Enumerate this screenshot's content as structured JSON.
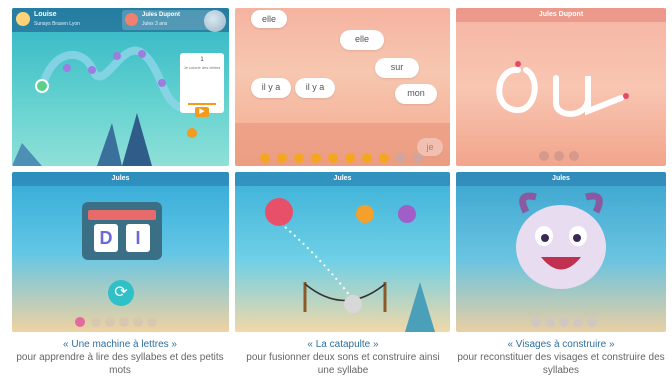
{
  "panel1": {
    "user_name": "Louise",
    "user_sub": "Sunays Brasen Lyon",
    "user2_name": "Jules Dupont",
    "user2_sub": "Jules 3 ans",
    "card_line": "Je colorie des lettres",
    "card_num": "1"
  },
  "panel2": {
    "words": [
      "elle",
      "elle",
      "sur",
      "il y a",
      "il y a",
      "mon",
      "je"
    ]
  },
  "panel3": {
    "title": "Jules Dupont",
    "word": "ou"
  },
  "panel4": {
    "title": "Jules",
    "letters": [
      "D",
      "I"
    ]
  },
  "panel5": {
    "title": "Jules"
  },
  "panel6": {
    "title": "Jules"
  },
  "captions": [
    {
      "title": "« Une machine à lettres »",
      "body": "pour apprendre à lire des syllabes et des petits mots"
    },
    {
      "title": "« La catapulte »",
      "body": "pour fusionner deux sons et construire ainsi une syllabe"
    },
    {
      "title": "« Visages à construire »",
      "body": "pour reconstituer des visages et construire des syllabes"
    }
  ],
  "colors": {
    "accent_orange": "#f49a1e",
    "caption_title": "#2f6fa0",
    "caption_body": "#666666"
  }
}
